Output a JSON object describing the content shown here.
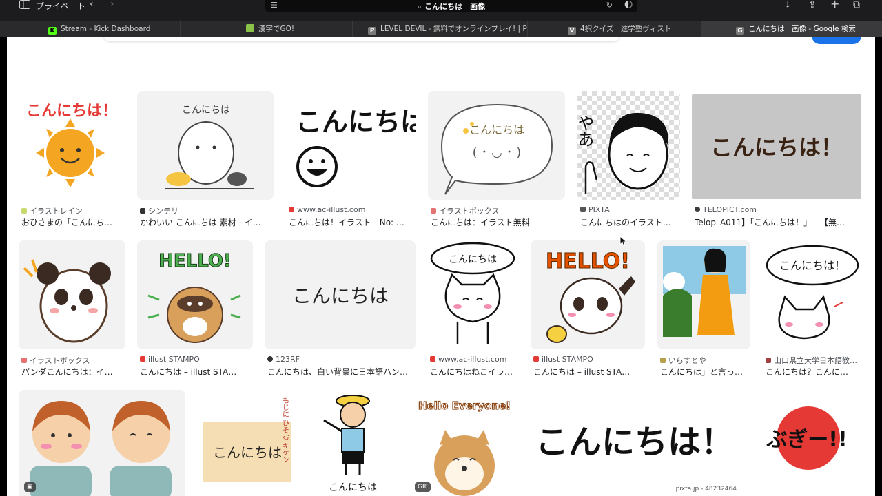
{
  "browser": {
    "private_label": "プライベート",
    "address_query": "こんにちは　画像",
    "tabs": [
      {
        "title": "Stream - Kick Dashboard",
        "favicon": "K",
        "color": "#53fc18"
      },
      {
        "title": "漢字でGO!",
        "favicon": "",
        "color": "#8bc34a"
      },
      {
        "title": "LEVEL DEVIL - 無料でオンラインプレイ! | Poki (…",
        "favicon": "P",
        "color": "#7a7a7a"
      },
      {
        "title": "4択クイズ｜進学塾ヴィスト",
        "favicon": "V",
        "color": "#7a7a7a"
      },
      {
        "title": "こんにちは　画像 - Google 検索",
        "favicon": "G",
        "color": "#7a7a7a"
      }
    ]
  },
  "results": {
    "row1": [
      {
        "source": "イラストレイン",
        "caption": "おひさまの「こんにち…",
        "thumb_text": "こんにちは！",
        "color": "#e53935"
      },
      {
        "source": "シンテリ",
        "caption": "かわいい こんにちは 素材｜イ…",
        "thumb_text": "こんにちは",
        "color": "#333"
      },
      {
        "source": "www.ac-illust.com",
        "caption": "こんにちは！イラスト - No: …",
        "thumb_text": "こんにちは!!",
        "color": "#111"
      },
      {
        "source": "イラストボックス",
        "caption": "こんにちは：イラスト無料",
        "thumb_text": "こんにちは",
        "color": "#7a6a3a"
      },
      {
        "source": "PIXTA",
        "caption": "こんにちはのイラスト…",
        "thumb_text": "やあ",
        "color": "#111"
      },
      {
        "source": "TELOPICT.com",
        "caption": "Telop_A011】「こんにちは！」 - 【無…",
        "thumb_text": "こんにちは！",
        "color": "#3b2314"
      }
    ],
    "row2": [
      {
        "source": "イラストボックス",
        "caption": "パンダこんにちは：イ…",
        "thumb_text": "",
        "color": "#333"
      },
      {
        "source": "illust STAMPO",
        "caption": "こんにちは – illust STA…",
        "thumb_text": "HELLO!",
        "color": "#2e7d32"
      },
      {
        "source": "123RF",
        "caption": "こんにちは、白い背景に日本語ハン…",
        "thumb_text": "こんにちは",
        "color": "#222"
      },
      {
        "source": "www.ac-illust.com",
        "caption": "こんにちはねこイラ…",
        "thumb_text": "こんにちは",
        "color": "#111"
      },
      {
        "source": "illust STAMPO",
        "caption": "こんにちは – illust STA…",
        "thumb_text": "HELLO!",
        "color": "#e65100"
      },
      {
        "source": "いらすとや",
        "caption": "こんにちは」と言っ…",
        "thumb_text": "",
        "color": "#333"
      },
      {
        "source": "山口県立大学日本語教…",
        "caption": "こんにちは？こんに…",
        "thumb_text": "こんにちは！",
        "color": "#111"
      }
    ],
    "row3": [
      {
        "thumb_text": "",
        "badge": ""
      },
      {
        "thumb_text": "こんにちは",
        "side_text": "もじに ひそむ キケン"
      },
      {
        "thumb_text": "こんにちは"
      },
      {
        "thumb_text": "Hello Everyone!",
        "badge": "GIF"
      },
      {
        "thumb_text": "こんにちは！",
        "watermark": "pixta.jp - 48232464"
      },
      {
        "thumb_text": "ぶぎー!!"
      }
    ]
  }
}
